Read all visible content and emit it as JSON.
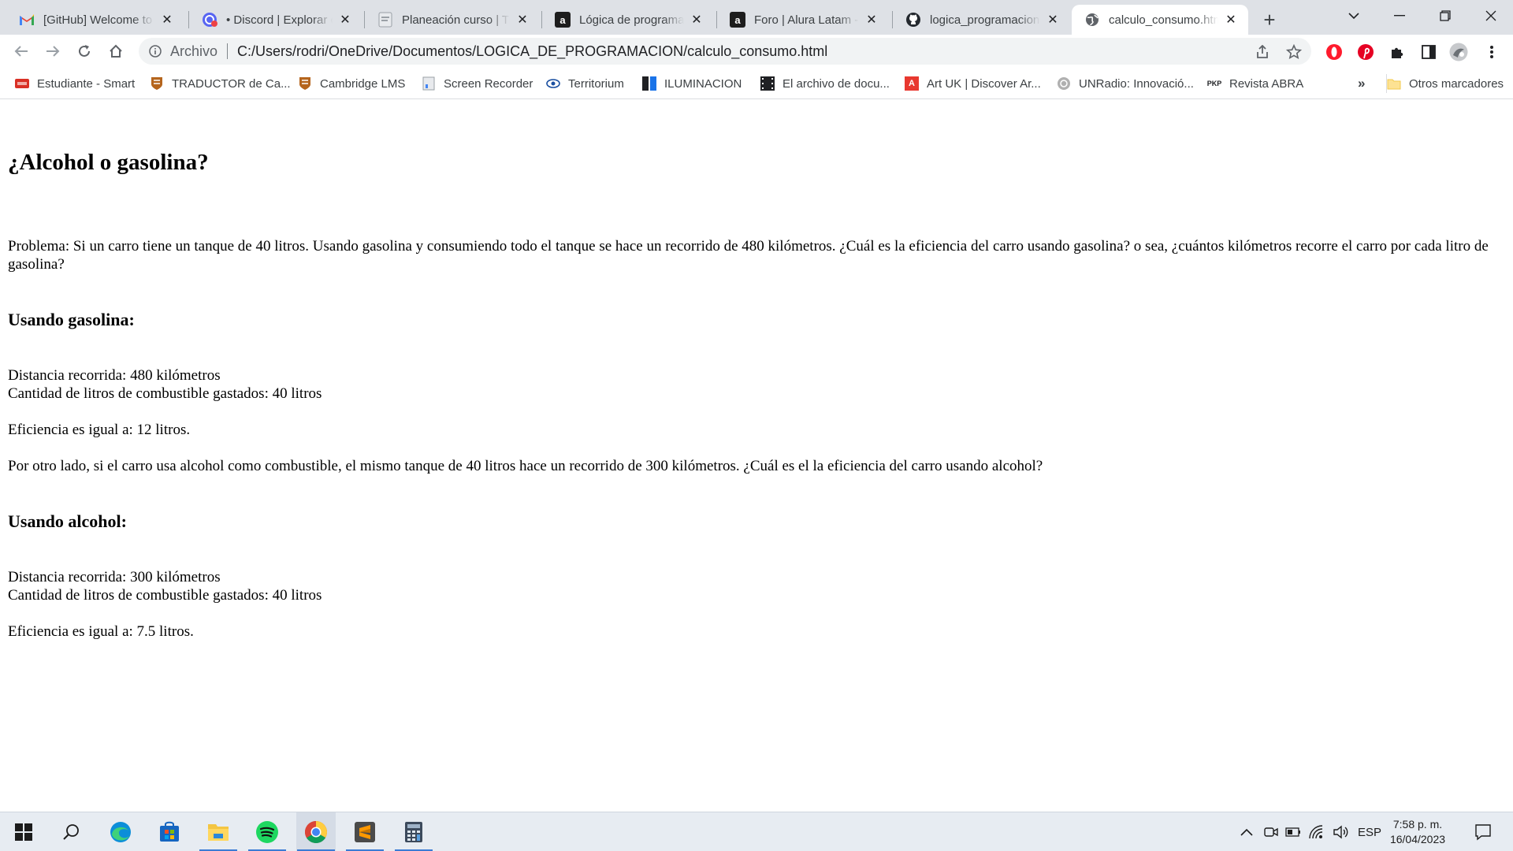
{
  "browser": {
    "tabs": [
      {
        "title": "[GitHub] Welcome to",
        "icon": "gmail-icon"
      },
      {
        "title": "• Discord | Explorar ca",
        "icon": "discord-icon"
      },
      {
        "title": "Planeación curso | Tre",
        "icon": "doc-icon"
      },
      {
        "title": "Lógica de programaci",
        "icon": "alura-icon"
      },
      {
        "title": "Foro | Alura Latam - C",
        "icon": "alura-icon"
      },
      {
        "title": "logica_programacion",
        "icon": "github-icon"
      },
      {
        "title": "calculo_consumo.htm",
        "icon": "globe-icon"
      }
    ],
    "active_tab_index": 6,
    "address": {
      "label": "Archivo",
      "url": "C:/Users/rodri/OneDrive/Documentos/LOGICA_DE_PROGRAMACION/calculo_consumo.html"
    },
    "bookmarks": [
      {
        "label": "Estudiante - Smart",
        "icon": "smart-icon",
        "color": "#d93025"
      },
      {
        "label": "TRADUCTOR de Ca...",
        "icon": "cambridge-icon",
        "color": "#b5651d"
      },
      {
        "label": "Cambridge LMS",
        "icon": "cambridge-icon",
        "color": "#b5651d"
      },
      {
        "label": "Screen Recorder",
        "icon": "recorder-icon",
        "color": "#5f6368"
      },
      {
        "label": "Territorium",
        "icon": "territorium-icon",
        "color": "#1a4fa0"
      },
      {
        "label": "ILUMINACION",
        "icon": "iluminacion-icon",
        "color": "#1a73e8"
      },
      {
        "label": "El archivo de docu...",
        "icon": "film-icon",
        "color": "#202124"
      },
      {
        "label": "Art UK | Discover Ar...",
        "icon": "artuk-icon",
        "color": "#e8382f"
      },
      {
        "label": "UNRadio: Innovació...",
        "icon": "unradio-icon",
        "color": "#8a8a8a"
      },
      {
        "label": "Revista ABRA",
        "icon": "pkp-icon",
        "color": "#202124"
      }
    ],
    "bookmarks_more": "»",
    "other_bookmarks": "Otros marcadores"
  },
  "page": {
    "title": "¿Alcohol o gasolina?",
    "problem": "Problema: Si un carro tiene un tanque de 40 litros. Usando gasolina y consumiendo todo el tanque se hace un recorrido de 480 kilómetros. ¿Cuál es la eficiencia del carro usando gasolina? o sea, ¿cuántos kilómetros recorre el carro por cada litro de gasolina?",
    "gasoline": {
      "heading": "Usando gasolina:",
      "distance": "Distancia recorrida: 480 kilómetros",
      "liters": "Cantidad de litros de combustible gastados: 40 litros",
      "efficiency": "Eficiencia es igual a: 12 litros."
    },
    "alcohol_intro": "Por otro lado, si el carro usa alcohol como combustible, el mismo tanque de 40 litros hace un recorrido de 300 kilómetros. ¿Cuál es el la eficiencia del carro usando alcohol?",
    "alcohol": {
      "heading": "Usando alcohol:",
      "distance": "Distancia recorrida: 300 kilómetros",
      "liters": "Cantidad de litros de combustible gastados: 40 litros",
      "efficiency": "Eficiencia es igual a: 7.5 litros."
    }
  },
  "taskbar": {
    "apps": [
      "start-icon",
      "search-icon",
      "edge-icon",
      "store-icon",
      "file-explorer-icon",
      "spotify-icon",
      "chrome-icon",
      "sublime-text-icon",
      "calculator-icon"
    ],
    "language": "ESP",
    "time": "7:58 p. m.",
    "date": "16/04/2023"
  },
  "colors": {
    "tabstrip": "#dee1e6",
    "omnibox": "#f1f3f4",
    "taskbar": "#e7ecf2",
    "running_indicator": "#3a7bd5"
  }
}
